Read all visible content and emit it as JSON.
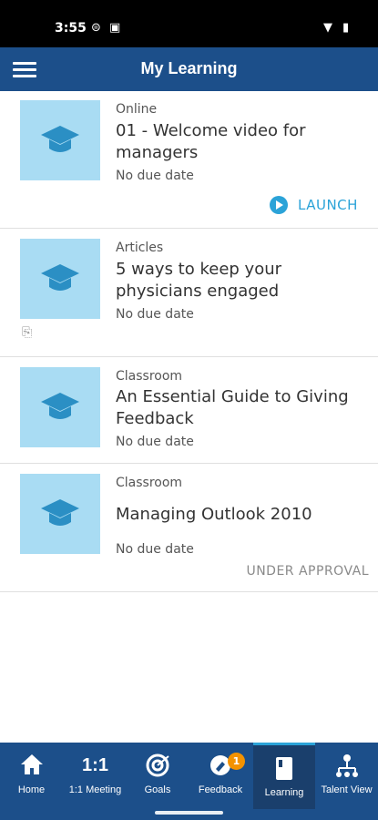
{
  "status": {
    "time": "3:55"
  },
  "header": {
    "title": "My Learning"
  },
  "items": [
    {
      "category": "Online",
      "title": "01 - Welcome video for managers",
      "due": "No due date",
      "action": "LAUNCH"
    },
    {
      "category": "Articles",
      "title": "5 ways to keep your physicians engaged",
      "due": "No due date"
    },
    {
      "category": "Classroom",
      "title": "An Essential Guide to Giving Feedback",
      "due": "No due date"
    },
    {
      "category": "Classroom",
      "title": "Managing Outlook 2010",
      "due": "No due date",
      "status": "UNDER APPROVAL"
    }
  ],
  "nav": {
    "home": "Home",
    "meeting": "1:1 Meeting",
    "meeting_icon_text": "1:1",
    "goals": "Goals",
    "feedback": "Feedback",
    "feedback_badge": "1",
    "learning": "Learning",
    "talent": "Talent View"
  },
  "colors": {
    "primary": "#1c4f8a",
    "accent": "#2ba3d8",
    "thumb": "#a9dcf3",
    "badge": "#f39200"
  },
  "icons": [
    "hamburger-menu-icon",
    "graduation-cap-icon",
    "play-icon",
    "paperclip-icon",
    "home-icon",
    "goals-icon",
    "feedback-icon",
    "learning-book-icon",
    "talent-view-icon"
  ]
}
